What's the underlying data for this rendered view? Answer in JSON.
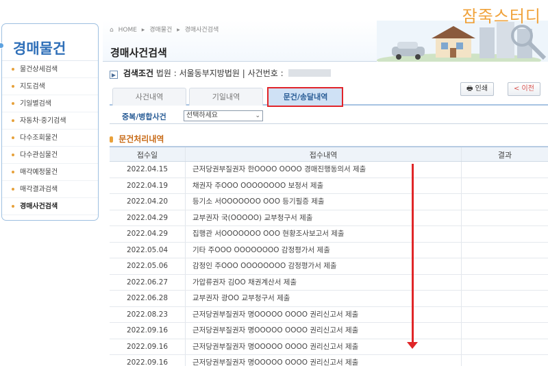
{
  "watermark": "잠죽스터디",
  "sidebar": {
    "title": "경매물건",
    "items": [
      {
        "label": "물건상세검색",
        "active": false
      },
      {
        "label": "지도검색",
        "active": false
      },
      {
        "label": "기일별검색",
        "active": false
      },
      {
        "label": "자동차·중기검색",
        "active": false
      },
      {
        "label": "다수조회물건",
        "active": false
      },
      {
        "label": "다수관심물건",
        "active": false
      },
      {
        "label": "매각예정물건",
        "active": false
      },
      {
        "label": "매각결과검색",
        "active": false
      },
      {
        "label": "경매사건검색",
        "active": true
      }
    ]
  },
  "breadcrumb": [
    "HOME",
    "경매물건",
    "경매사건검색"
  ],
  "page_title": "경매사건검색",
  "search_condition": {
    "label": "검색조건",
    "court_label": "법원 : 서울동부지방법원",
    "separator": "|",
    "case_label": "사건번호 :"
  },
  "tabs": [
    {
      "label": "사건내역",
      "active": false
    },
    {
      "label": "기일내역",
      "active": false
    },
    {
      "label": "문건/송달내역",
      "active": true
    }
  ],
  "buttons": {
    "print": "인쇄",
    "prev": "< 이전"
  },
  "merge": {
    "label": "중복/병합사건",
    "select_value": "선택하세요"
  },
  "section_title": "문건처리내역",
  "table": {
    "headers": [
      "접수일",
      "접수내역",
      "결과"
    ],
    "rows": [
      {
        "date": "2022.04.15",
        "desc": "근저당권부질권자 한OOOO OOOO 경매진행동의서 제출",
        "result": ""
      },
      {
        "date": "2022.04.19",
        "desc": "채권자 주OOO OOOOOOOO 보정서 제출",
        "result": ""
      },
      {
        "date": "2022.04.20",
        "desc": "등기소 서OOOOOOO OOO 등기필증 제출",
        "result": ""
      },
      {
        "date": "2022.04.29",
        "desc": "교부권자 국(OOOOO) 교부청구서 제출",
        "result": ""
      },
      {
        "date": "2022.04.29",
        "desc": "집행관 서OOOOOOO OOO 현황조사보고서 제출",
        "result": ""
      },
      {
        "date": "2022.05.04",
        "desc": "기타 주OOO OOOOOOOO 감정평가서 제출",
        "result": ""
      },
      {
        "date": "2022.05.06",
        "desc": "감정인 주OOO OOOOOOOO 감정평가서 제출",
        "result": ""
      },
      {
        "date": "2022.06.27",
        "desc": "가압류권자 김OO 채권계산서 제출",
        "result": ""
      },
      {
        "date": "2022.06.28",
        "desc": "교부권자 광OO 교부청구서 제출",
        "result": ""
      },
      {
        "date": "2022.08.23",
        "desc": "근저당권부질권자 명OOOOO OOOO 권리신고서 제출",
        "result": ""
      },
      {
        "date": "2022.09.16",
        "desc": "근저당권부질권자 명OOOOO OOOO 권리신고서 제출",
        "result": ""
      },
      {
        "date": "2022.09.16",
        "desc": "근저당권부질권자 명OOOOO OOOO 권리신고서 제출",
        "result": ""
      },
      {
        "date": "2022.09.16",
        "desc": "근저당권부질권자 명OOOOO OOOO 권리신고서 제출",
        "result": ""
      }
    ]
  },
  "colors": {
    "accent_blue": "#2f6fb8",
    "highlight_red": "#e1242a",
    "watermark_orange": "#f0a23a"
  }
}
